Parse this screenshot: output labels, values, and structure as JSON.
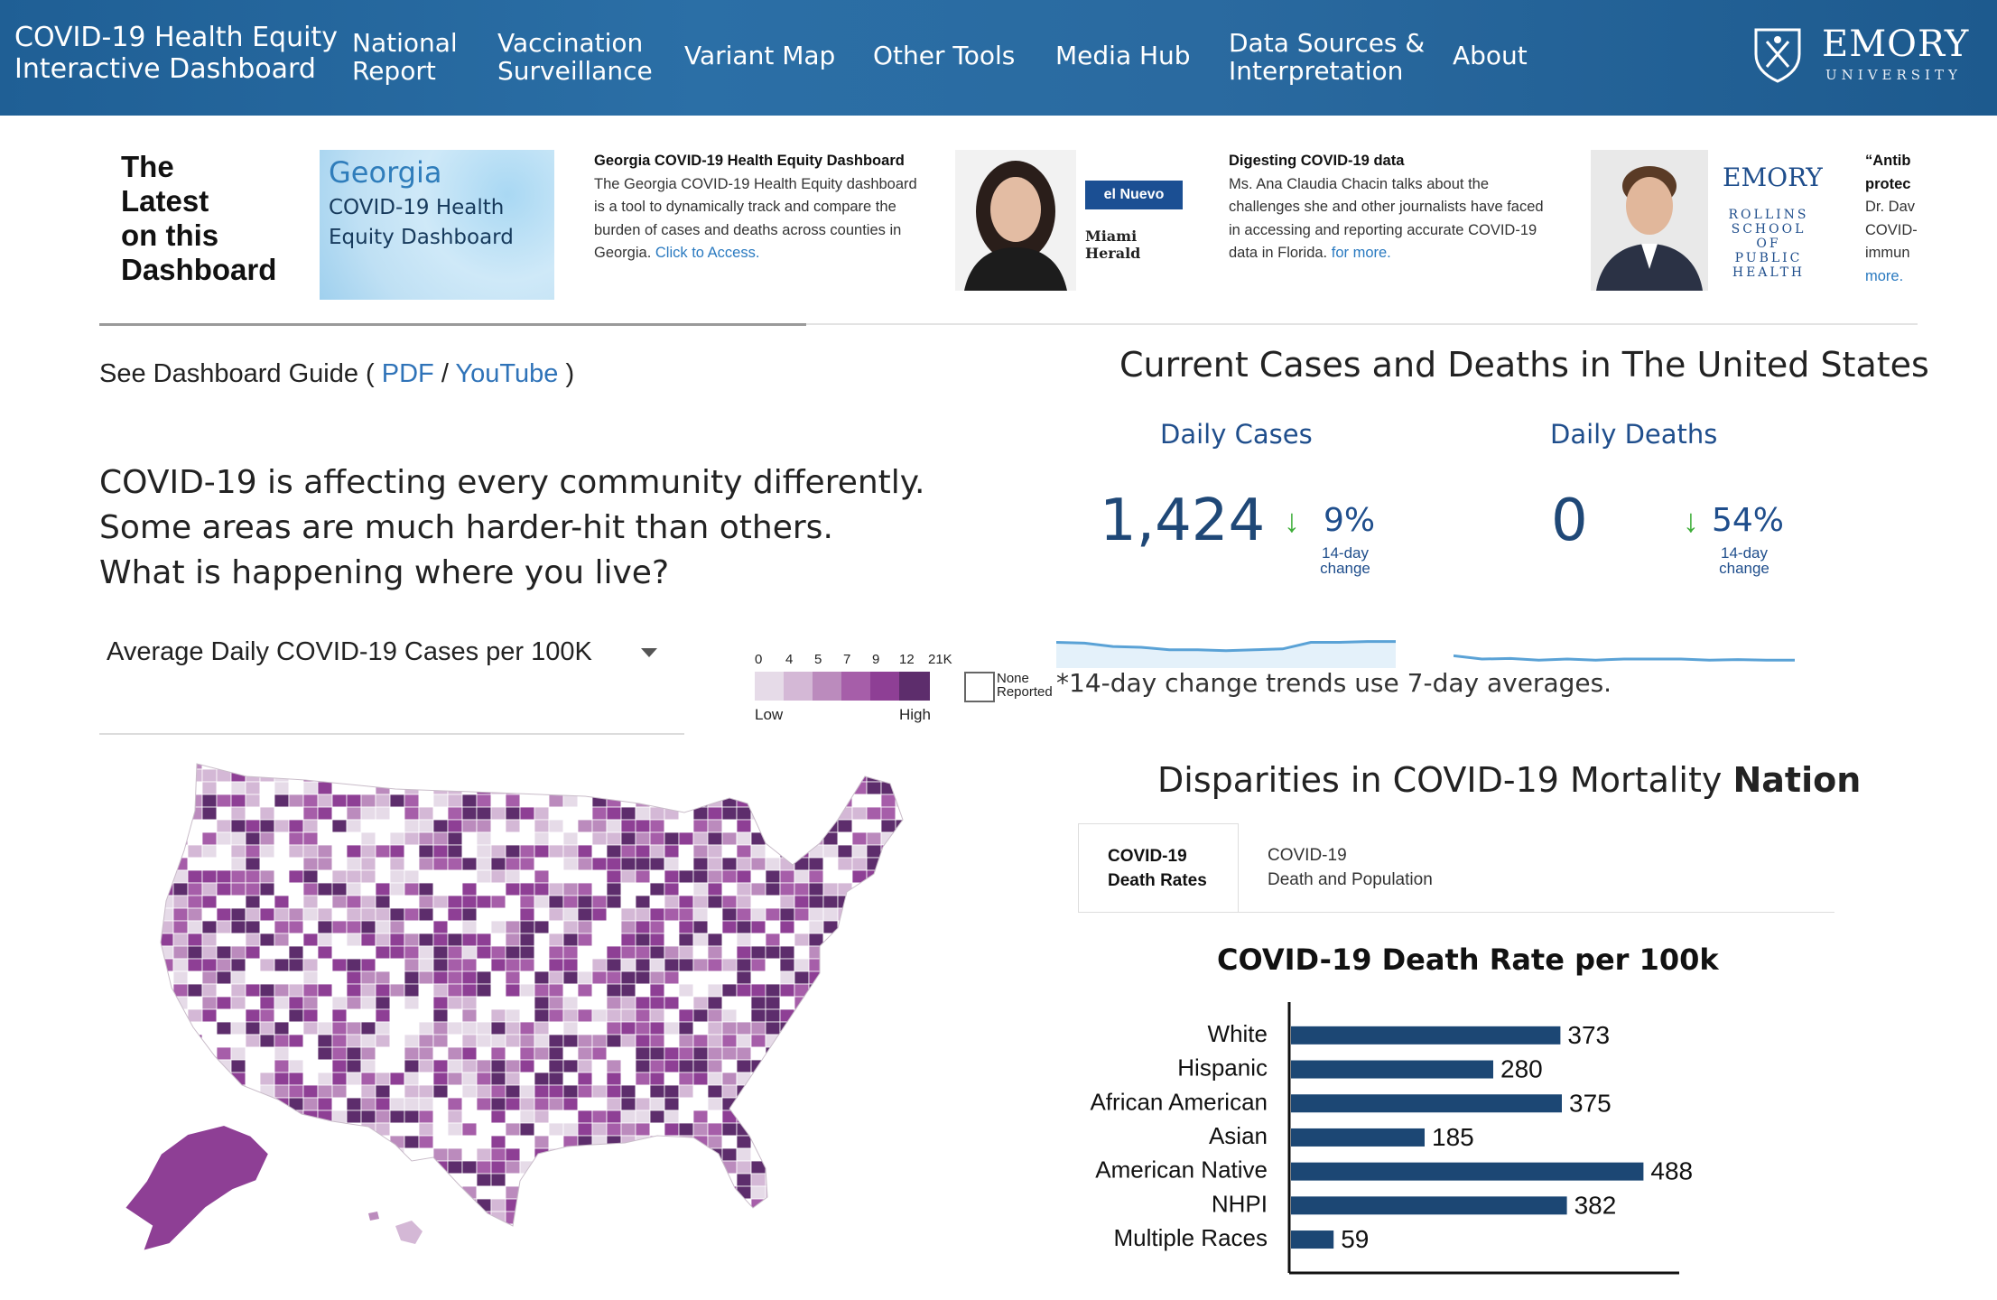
{
  "nav": {
    "brand": "COVID-19 Health Equity\nInteractive Dashboard",
    "items": [
      "National\nReport",
      "Vaccination\nSurveillance",
      "Variant Map",
      "Other Tools",
      "Media Hub",
      "Data Sources &\nInterpretation",
      "About"
    ],
    "logo_name": "EMORY",
    "logo_sub": "UNIVERSITY"
  },
  "latest": {
    "title": "The\nLatest\non this\nDashboard",
    "cards": [
      {
        "thumb_title": "Georgia",
        "thumb_sub": "COVID-19 Health\nEquity Dashboard",
        "headline": "Georgia COVID-19 Health Equity Dashboard",
        "body": "The Georgia COVID-19 Health Equity dashboard is a tool to dynamically track and compare the burden of cases and deaths across counties in Georgia.",
        "link": "Click to Access."
      },
      {
        "logo1": "el Nuevo Herald",
        "logo2": "Miami Herald",
        "headline": "Digesting COVID-19 data",
        "body": "Ms. Ana Claudia Chacin talks about the challenges she and other journalists have faced in accessing and reporting accurate COVID-19 data in Florida.",
        "link": "for more."
      },
      {
        "logo_name": "EMORY",
        "logo_sub": "ROLLINS\nSCHOOL OF\nPUBLIC\nHEALTH",
        "headline": "“Antib",
        "headline2": "protec",
        "body": "Dr. Dav\nCOVID-\nimmun",
        "link": "more."
      }
    ]
  },
  "guide": {
    "prefix": "See Dashboard Guide (",
    "pdf": "PDF",
    "sep": "/",
    "youtube": "YouTube",
    "suffix": ")"
  },
  "tagline": "COVID-19 is affecting every community differently.\nSome areas are much harder-hit than others.\nWhat is happening where you live?",
  "metric_select": {
    "value": "Average Daily COVID-19 Cases per 100K"
  },
  "legend": {
    "ticks": [
      "0",
      "4",
      "5",
      "7",
      "9",
      "12",
      "21K"
    ],
    "low": "Low",
    "high": "High",
    "none": "None\nReported",
    "colors": [
      "#e6dbe8",
      "#d4b8d6",
      "#bb8bbd",
      "#a65ea9",
      "#8e3f95",
      "#5d2d6c"
    ]
  },
  "trend_note": "*14-day change trends use 7-day averages.",
  "current": {
    "title": "Current Cases and Deaths in The United States",
    "cases": {
      "label": "Daily Cases",
      "value": "1,424",
      "pct": "9%",
      "sub": "14-day\nchange",
      "trend": [
        0.62,
        0.6,
        0.52,
        0.5,
        0.44,
        0.44,
        0.42,
        0.44,
        0.46,
        0.62,
        0.62,
        0.64,
        0.64
      ]
    },
    "deaths": {
      "label": "Daily Deaths",
      "value": "0",
      "pct": "54%",
      "sub": "14-day\nchange",
      "trend": [
        0.52,
        0.4,
        0.42,
        0.36,
        0.4,
        0.36,
        0.4,
        0.4,
        0.4,
        0.36,
        0.38,
        0.36,
        0.36
      ]
    }
  },
  "disparities": {
    "title_prefix": "Disparities in COVID-19 Mortality",
    "title_scope": "Nation",
    "tabs": [
      "COVID-19\nDeath Rates",
      "COVID-19\nDeath and Population"
    ],
    "chart_title": "COVID-19 Death Rate per 100k"
  },
  "chart_data": {
    "type": "bar",
    "orientation": "horizontal",
    "title": "COVID-19 Death Rate per 100k",
    "categories": [
      "White",
      "Hispanic",
      "African American",
      "Asian",
      "American Native",
      "NHPI",
      "Multiple Races"
    ],
    "values": [
      373,
      280,
      375,
      185,
      488,
      382,
      59
    ],
    "xlim": [
      0,
      550
    ],
    "bar_color": "#1c4774"
  }
}
